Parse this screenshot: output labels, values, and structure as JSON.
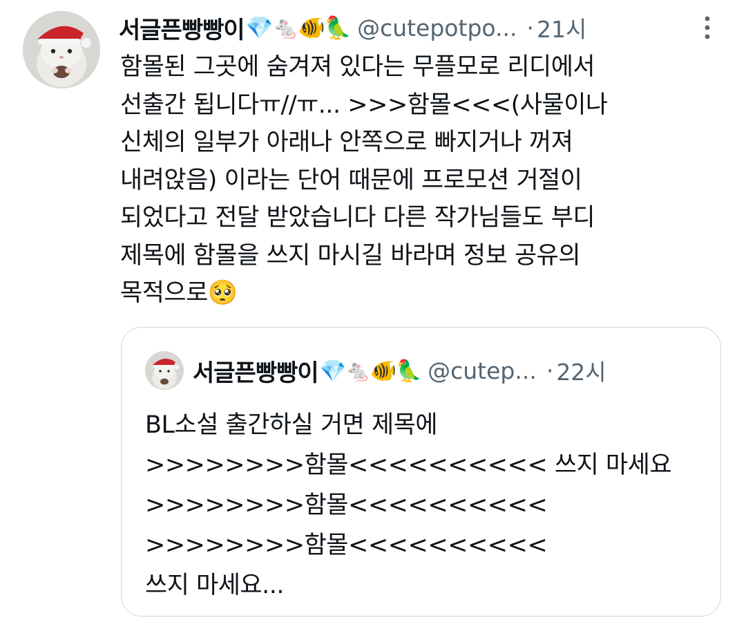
{
  "tweet": {
    "author_name": "서글픈빵빵이",
    "author_emojis": "💎🐁🐠🦜",
    "handle": "@cutepotpo...",
    "separator": "·",
    "time": "21시",
    "more_icon": "more-vertical-icon",
    "lines": [
      "함몰된 그곳에 숨겨져 있다는 무플모로 리디에서",
      "선출간 됩니다ㅠ//ㅠ... >>>함몰<<<(사물이나",
      "신체의 일부가 아래나 안쪽으로 빠지거나 꺼져",
      "내려앉음) 이라는 단어 때문에 프로모션 거절이",
      "되었다고 전달 받았습니다 다른 작가님들도 부디",
      "제목에 함몰을 쓰지 마시길 바라며 정보 공유의",
      "목적으로🥺"
    ]
  },
  "quoted": {
    "author_name": "서글픈빵빵이",
    "author_emojis": "💎🐁🐠🦜",
    "handle": "@cutep...",
    "separator": "·",
    "time": "22시",
    "lines": [
      "BL소설 출간하실 거면 제목에",
      ">>>>>>>>함몰<<<<<<<<<< 쓰지 마세요",
      ">>>>>>>>함몰<<<<<<<<<<",
      ">>>>>>>>함몰<<<<<<<<<<",
      "쓰지 마세요..."
    ]
  },
  "colors": {
    "text": "#0f1419",
    "secondary": "#536471",
    "border": "#cfd9de"
  }
}
